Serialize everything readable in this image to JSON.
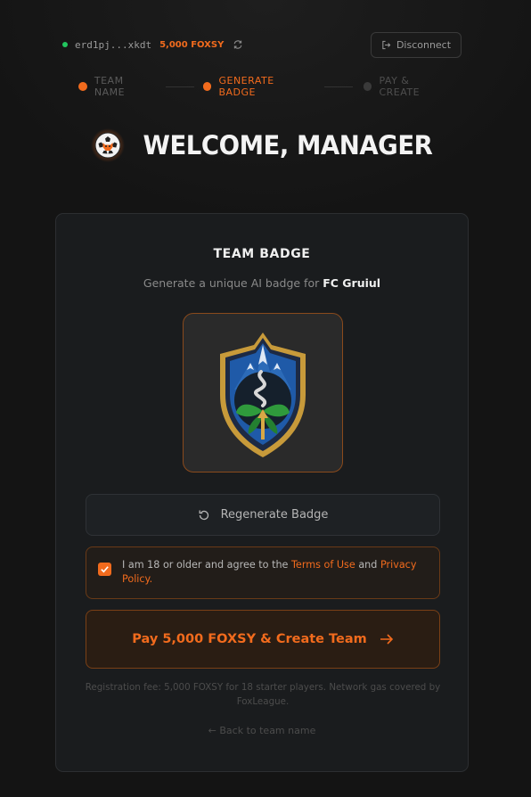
{
  "wallet": {
    "address": "erd1pj...xkdt",
    "balance": "5,000 FOXSY",
    "status_color": "#22c55e",
    "refresh_icon": "refresh-icon"
  },
  "header": {
    "disconnect_label": "Disconnect",
    "disconnect_icon": "logout-icon"
  },
  "stepper": {
    "steps": [
      {
        "label": "TEAM NAME",
        "state": "done"
      },
      {
        "label": "GENERATE BADGE",
        "state": "active"
      },
      {
        "label": "PAY & CREATE",
        "state": "todo"
      }
    ]
  },
  "page": {
    "title": "WELCOME, MANAGER",
    "logo_icon": "soccer-ball-fox-icon"
  },
  "card": {
    "title": "TEAM BADGE",
    "subtitle_prefix": "Generate a unique AI badge for",
    "team_name": "FC Gruiul",
    "badge_image": "team-badge-crest",
    "regenerate_label": "Regenerate Badge",
    "terms": {
      "checked": true,
      "text_prefix": "I am 18 or older and agree to the",
      "terms_link": "Terms of Use",
      "and": "and",
      "privacy_link": "Privacy Policy",
      "suffix": "."
    },
    "pay_label": "Pay 5,000 FOXSY & Create Team",
    "fee_note": "Registration fee: 5,000 FOXSY for 18 starter players. Network gas covered by FoxLeague.",
    "back_label": "← Back to team name"
  },
  "colors": {
    "accent": "#f26b1d",
    "background": "#141414",
    "card": "#1a1c1e"
  }
}
